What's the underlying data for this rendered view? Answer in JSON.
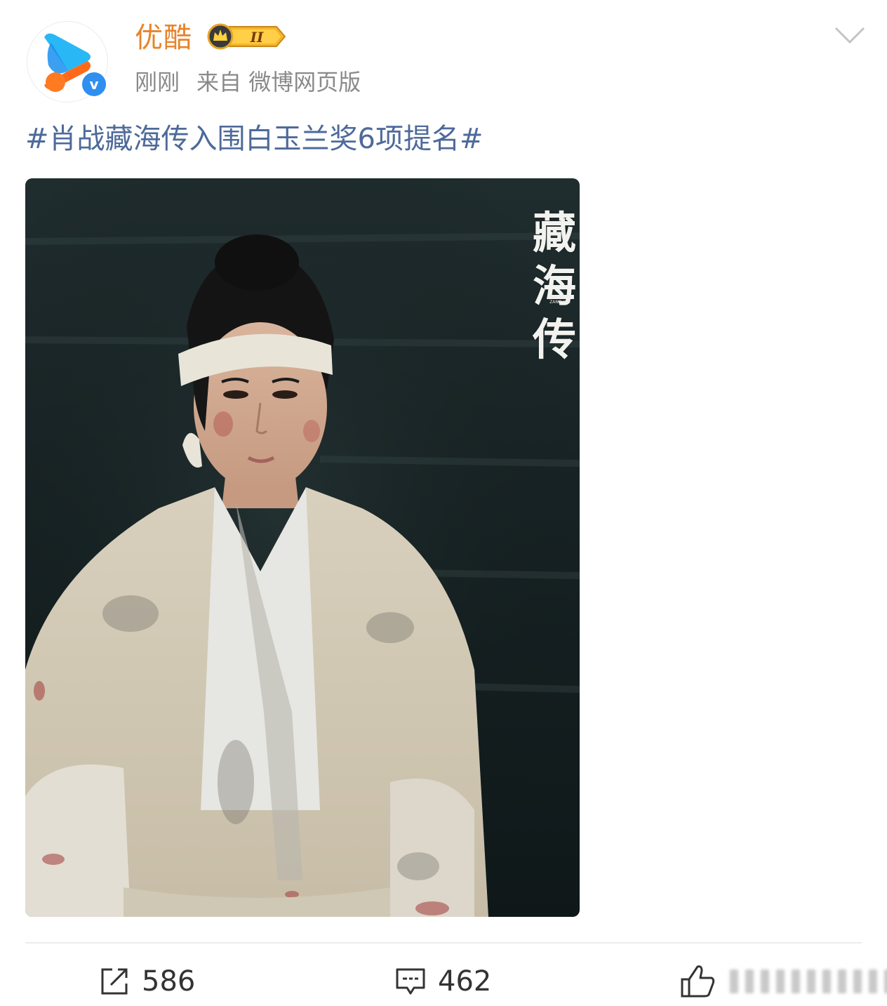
{
  "header": {
    "user_name": "优酷",
    "vip_level": "II",
    "time": "刚刚",
    "source": "来自 微博网页版"
  },
  "post": {
    "text": "#肖战藏海传入围白玉兰奖6项提名#"
  },
  "image": {
    "title": "藏海传",
    "subtitle": "LEGEND OF ZANG HAI"
  },
  "actions": {
    "reposts": "586",
    "comments": "462"
  },
  "colors": {
    "username": "#e8832a",
    "topic_link": "#4e6a9a",
    "meta": "#8a8a8a",
    "verified": "#2f8ff0"
  }
}
